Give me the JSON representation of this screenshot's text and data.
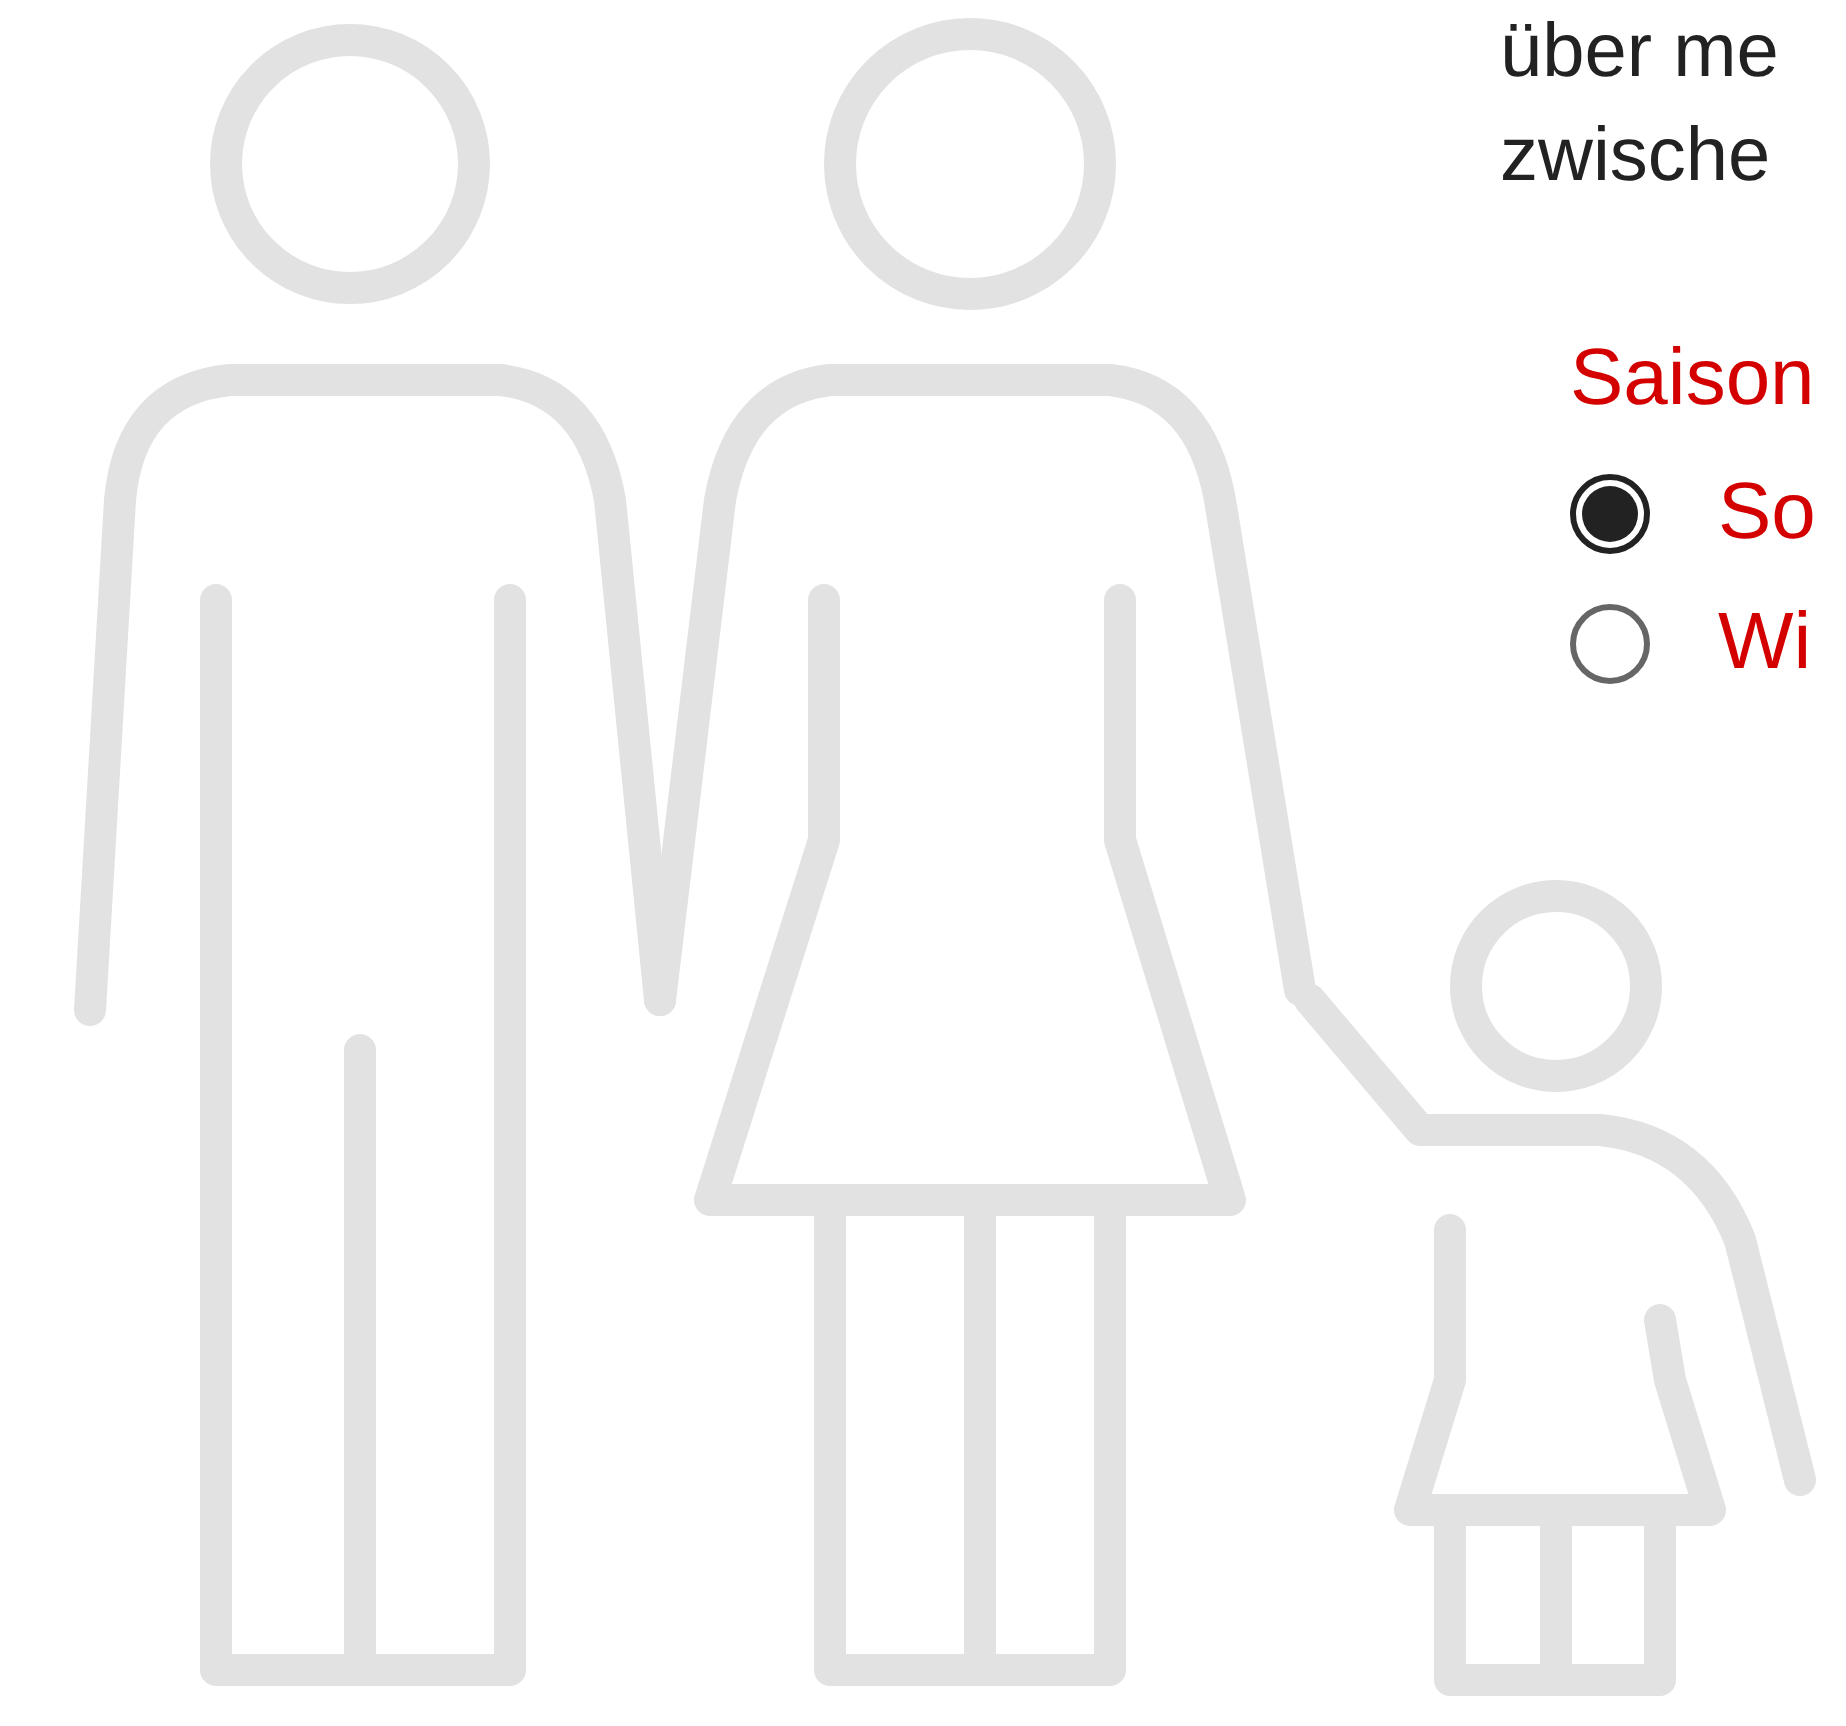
{
  "intro_lines": [
    "über me",
    "zwische"
  ],
  "season": {
    "label": "Saison",
    "options": [
      {
        "label": "So",
        "selected": true
      },
      {
        "label": "Wi",
        "selected": false
      }
    ]
  }
}
